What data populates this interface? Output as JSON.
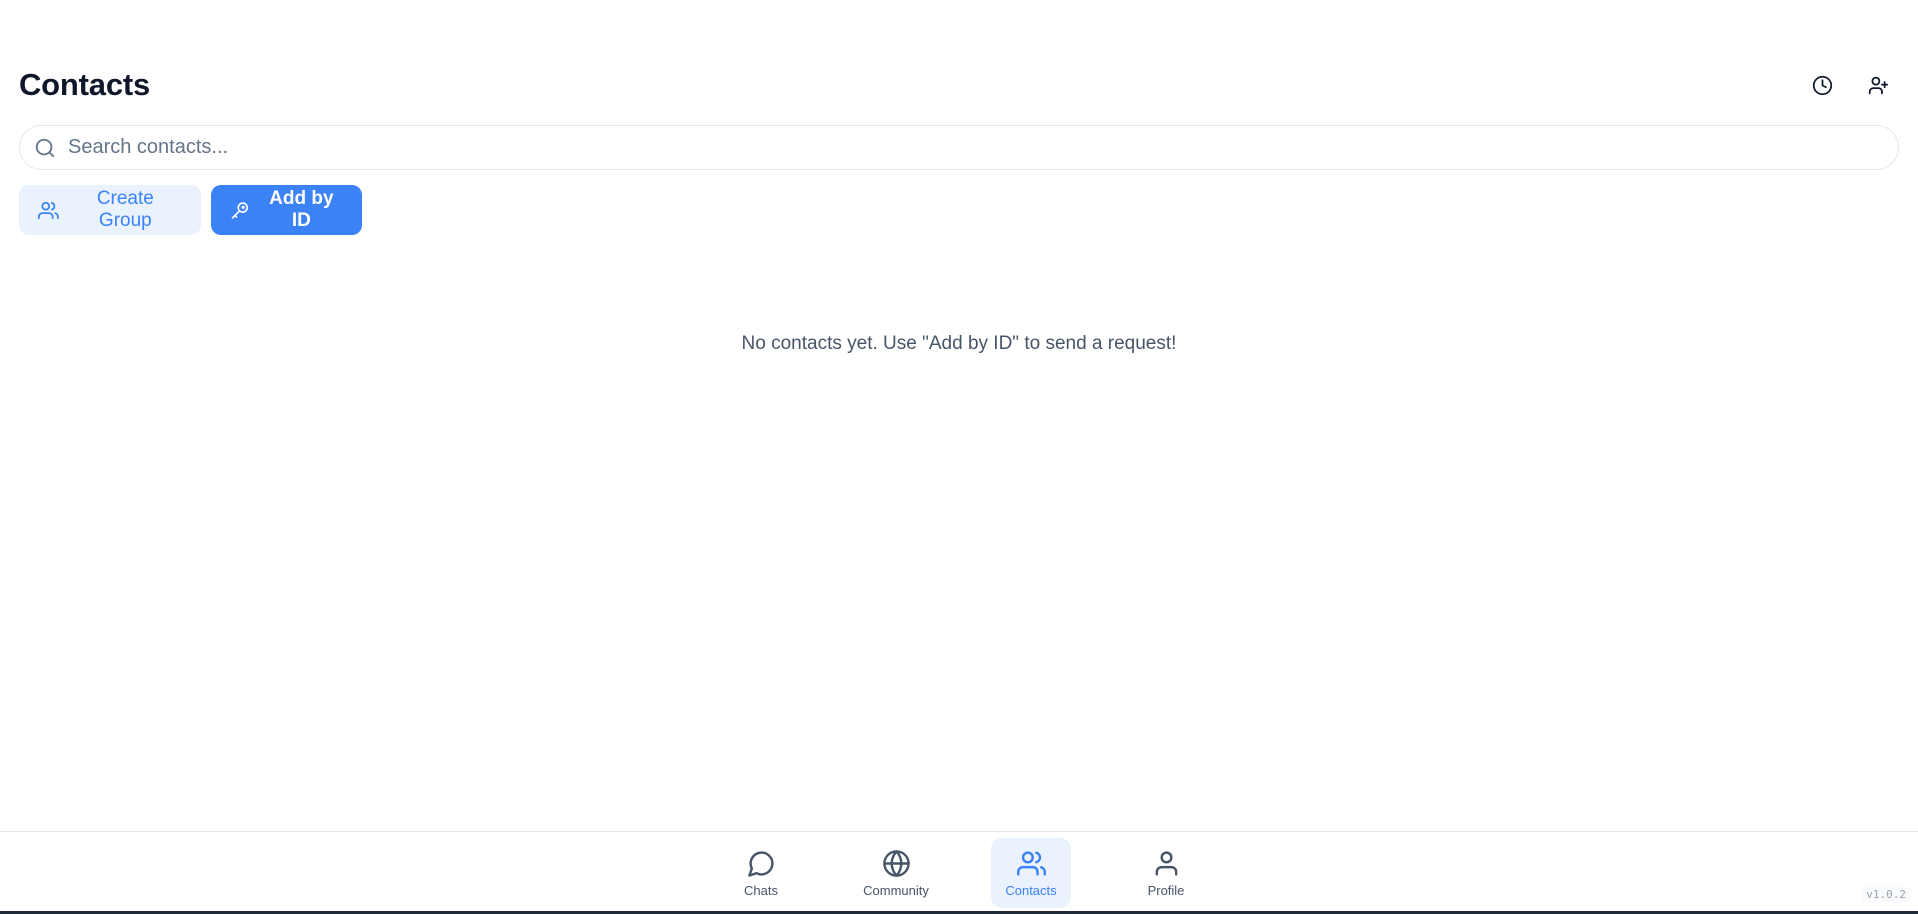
{
  "header": {
    "title": "Contacts",
    "history_icon": "clock-icon",
    "add_contact_icon": "user-plus-icon"
  },
  "search": {
    "placeholder": "Search contacts...",
    "value": "",
    "icon": "search-icon"
  },
  "actions": {
    "create_group": {
      "label": "Create Group",
      "icon": "users-icon"
    },
    "add_by_id": {
      "label": "Add by ID",
      "icon": "key-icon"
    }
  },
  "empty_state": {
    "message": "No contacts yet. Use \"Add by ID\" to send a request!"
  },
  "bottom_nav": {
    "items": [
      {
        "label": "Chats",
        "icon": "chat-bubble-icon",
        "active": false
      },
      {
        "label": "Community",
        "icon": "globe-icon",
        "active": false
      },
      {
        "label": "Contacts",
        "icon": "users-icon",
        "active": true
      },
      {
        "label": "Profile",
        "icon": "user-icon",
        "active": false
      }
    ]
  },
  "version": "v1.0.2",
  "colors": {
    "accent": "#3b82f6",
    "accent_light": "#eaf2fd",
    "text": "#0f172a",
    "muted": "#475569"
  }
}
